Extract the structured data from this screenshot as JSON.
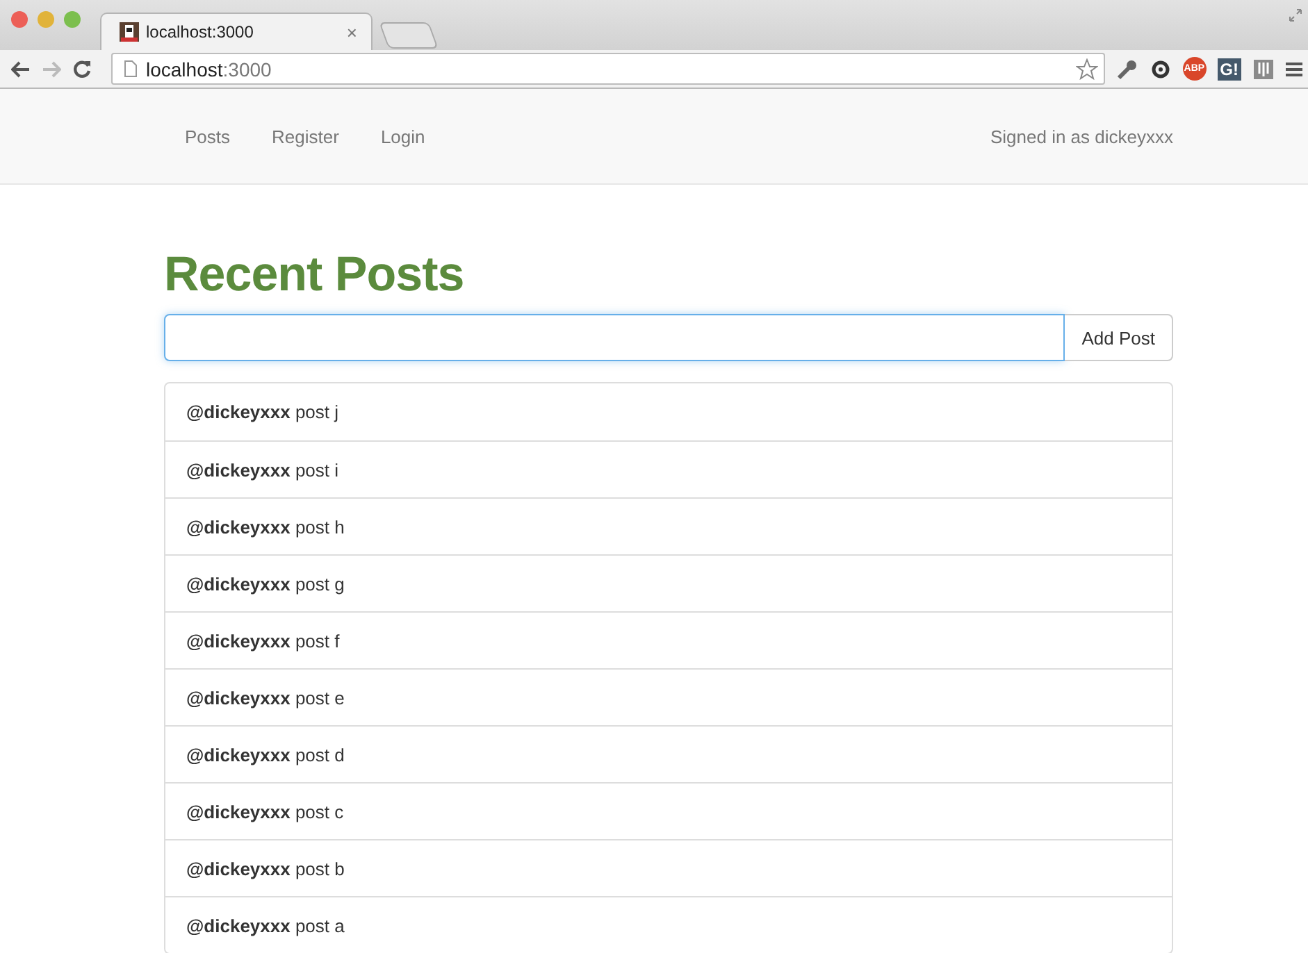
{
  "browser": {
    "tab": {
      "title": "localhost:3000",
      "close": "×"
    },
    "address": {
      "host": "localhost",
      "port": ":3000"
    },
    "extensions": [
      {
        "kind": "abp",
        "label": "ABP"
      },
      {
        "kind": "g",
        "label": "G!"
      }
    ]
  },
  "navbar": {
    "links": [
      {
        "label": "Posts"
      },
      {
        "label": "Register"
      },
      {
        "label": "Login"
      }
    ],
    "signed_in": "Signed in as dickeyxxx"
  },
  "heading": "Recent Posts",
  "new_post": {
    "button": "Add Post"
  },
  "posts": [
    {
      "text": "**@dickeyxxx** post j"
    },
    {
      "text": "**@dickeyxxx** post i"
    },
    {
      "text": "**@dickeyxxx** post h"
    },
    {
      "text": "**@dickeyxxx** post g"
    },
    {
      "text": "**@dickeyxxx** post f"
    },
    {
      "text": "**@dickeyxxx** post e"
    },
    {
      "text": "**@dickeyxxx** post d"
    },
    {
      "text": "**@dickeyxxx** post c"
    },
    {
      "text": "**@dickeyxxx** post b"
    },
    {
      "text": "**@dickeyxxx** post a"
    }
  ]
}
